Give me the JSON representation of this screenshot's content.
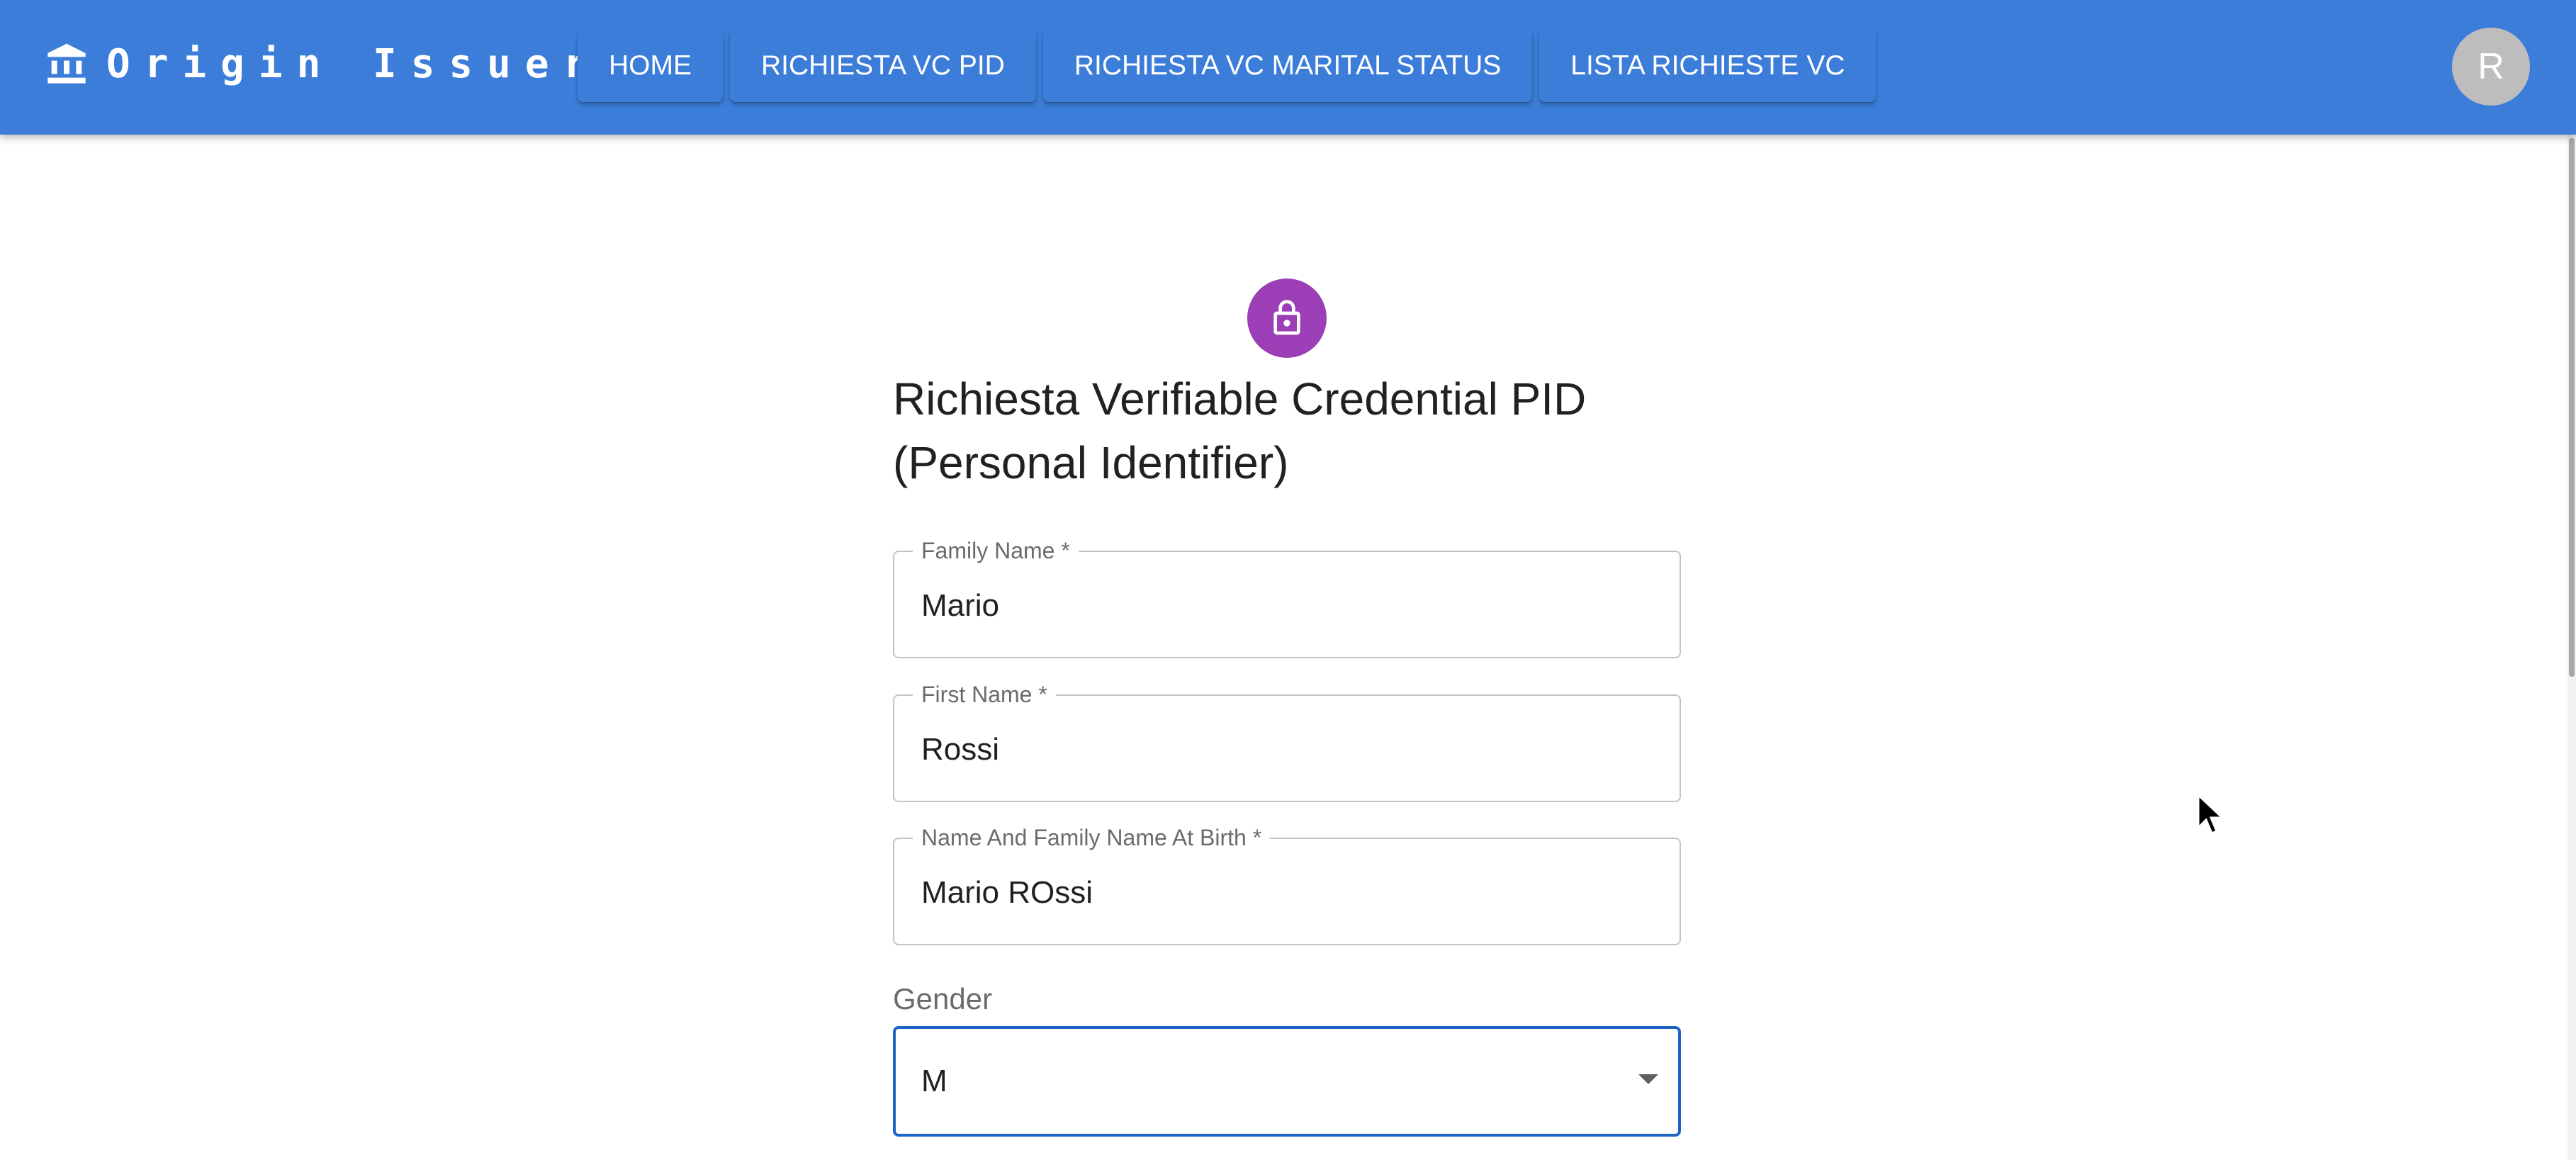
{
  "appbar": {
    "brand_icon": "bank-icon",
    "brand_title": "Origin Issuer",
    "nav_items": [
      "HOME",
      "RICHIESTA VC PID",
      "RICHIESTA VC MARITAL STATUS",
      "LISTA RICHIESTE VC"
    ],
    "avatar_initial": "R",
    "background_color": "#3b7dd8"
  },
  "form": {
    "header_icon": "lock-icon",
    "header_icon_color": "#9c3fb7",
    "title_line1": "Richiesta Verifiable Credential PID",
    "title_line2": "(Personal Identifier)",
    "fields": [
      {
        "label": "Family Name *",
        "value": "Mario"
      },
      {
        "label": "First Name *",
        "value": "Rossi"
      },
      {
        "label": "Name And Family Name At Birth *",
        "value": "Mario ROssi"
      }
    ],
    "gender": {
      "label": "Gender",
      "selected": "M",
      "icon": "chevron-down-icon",
      "focus_color": "#1e63c6"
    }
  }
}
